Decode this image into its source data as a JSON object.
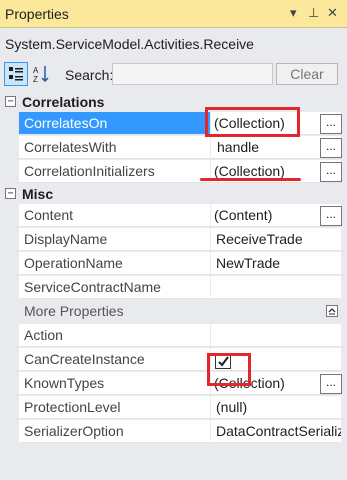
{
  "window": {
    "title": "Properties",
    "dropdown_glyph": "▾",
    "pin_glyph": "⊥",
    "close_glyph": "✕"
  },
  "type_name": "System.ServiceModel.Activities.Receive",
  "toolbar": {
    "search_label": "Search:",
    "search_value": "",
    "clear_label": "Clear"
  },
  "categories": [
    {
      "label": "Correlations",
      "toggle": "−",
      "properties": [
        {
          "name": "CorrelatesOn",
          "value": "(Collection)",
          "selected": true,
          "ellipsis": "..."
        },
        {
          "name": "CorrelatesWith",
          "value": "handle",
          "ellipsis": "..."
        },
        {
          "name": "CorrelationInitializers",
          "value": "(Collection)",
          "ellipsis": "..."
        }
      ]
    },
    {
      "label": "Misc",
      "toggle": "−",
      "properties": [
        {
          "name": "Content",
          "value": "(Content)",
          "ellipsis": "..."
        },
        {
          "name": "DisplayName",
          "value": "ReceiveTrade"
        },
        {
          "name": "OperationName",
          "value": "NewTrade"
        },
        {
          "name": "ServiceContractName",
          "value": ""
        }
      ],
      "more_properties": {
        "label": "More Properties",
        "properties": [
          {
            "name": "Action",
            "value": ""
          },
          {
            "name": "CanCreateInstance",
            "checked": true
          },
          {
            "name": "KnownTypes",
            "value": "(Collection)",
            "ellipsis": "..."
          },
          {
            "name": "ProtectionLevel",
            "value": "(null)"
          },
          {
            "name": "SerializerOption",
            "value": "DataContractSerializer"
          }
        ]
      }
    }
  ],
  "colors": {
    "title_bar": "#fbe89a",
    "selection": "#3399ff",
    "annotation": "#e3262e",
    "panel_bg": "#e8eaee"
  }
}
